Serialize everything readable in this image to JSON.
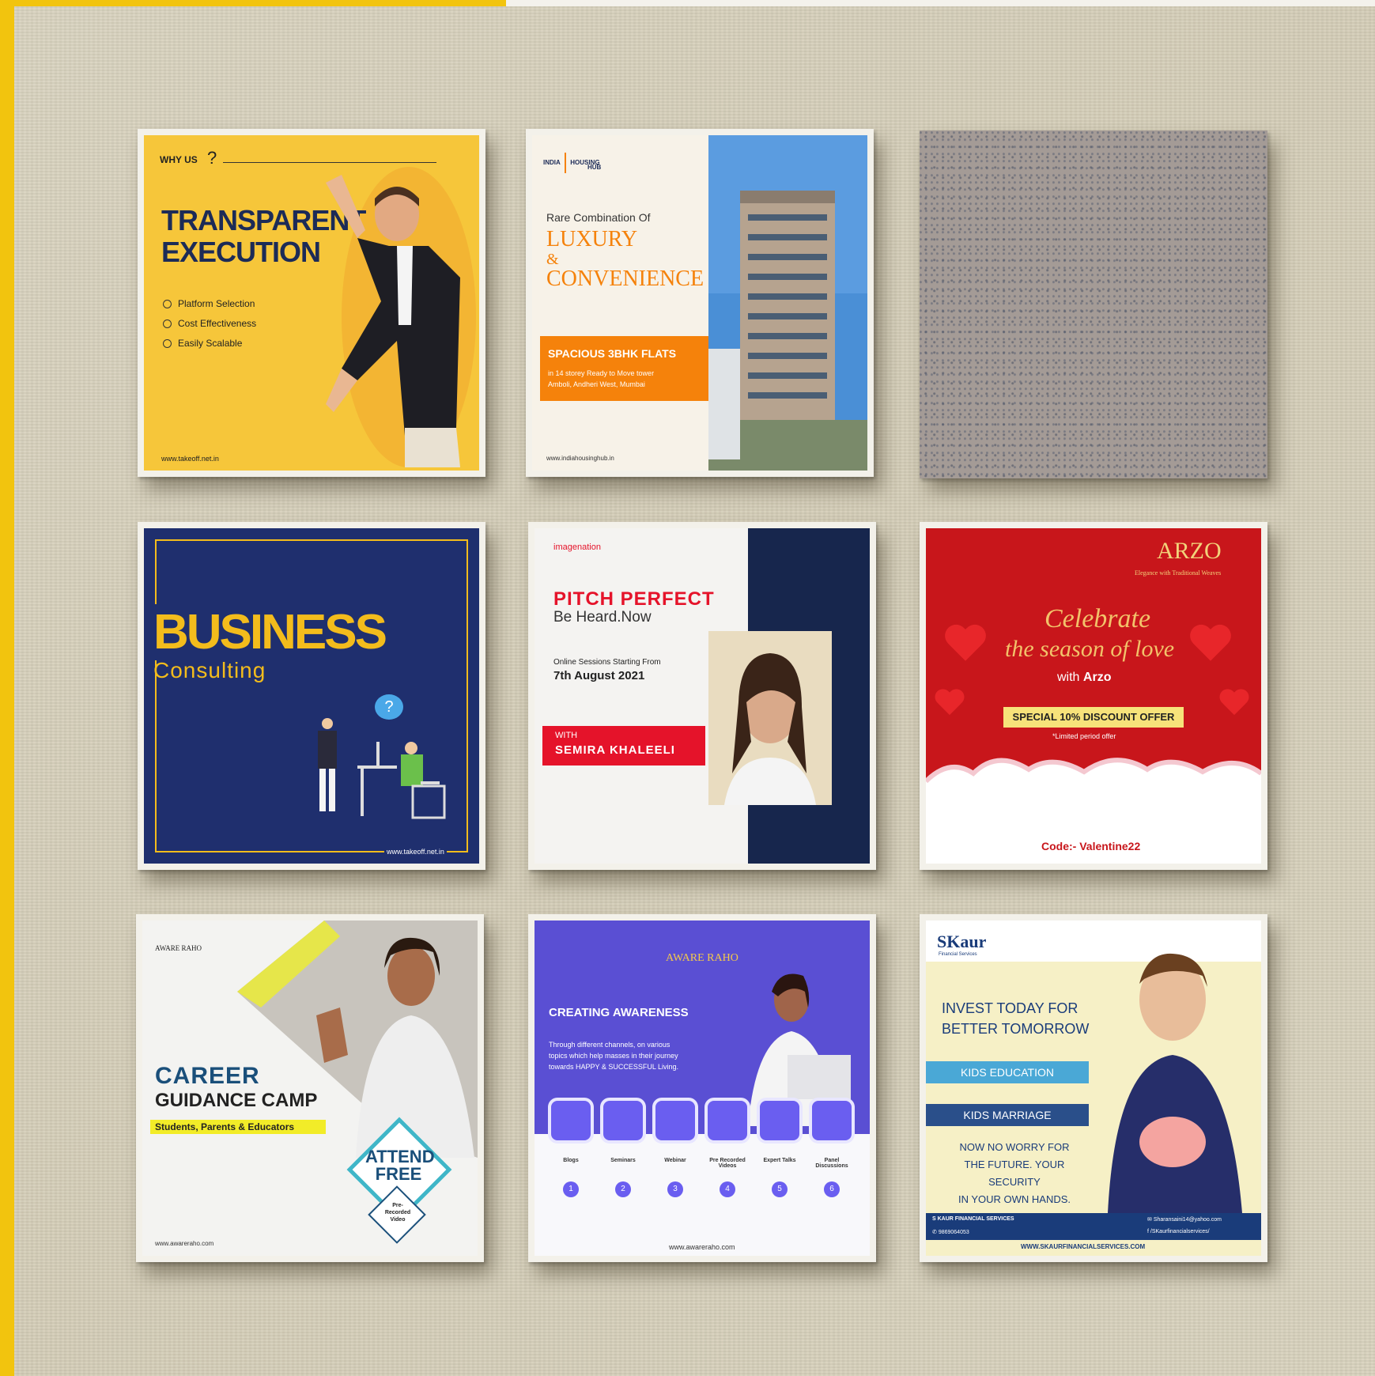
{
  "colors": {
    "yellow": "#f2c40e",
    "navy": "#1f2f6e",
    "orange": "#f5820b",
    "red": "#c8161b",
    "purple": "#5a4fd3"
  },
  "card1": {
    "why_us": "WHY US",
    "title_line1": "TRANSPARENT",
    "title_line2": "EXECUTION",
    "bullets": [
      "Platform Selection",
      "Cost Effectiveness",
      "Easily Scalable"
    ],
    "url": "www.takeoff.net.in"
  },
  "card2": {
    "logo_line1": "INDIA",
    "logo_line2": "HOUSING",
    "logo_line3": "HUB",
    "intro": "Rare Combination Of",
    "word1": "LUXURY",
    "amp": "&",
    "word2": "CONVENIENCE",
    "banner_title": "SPACIOUS 3BHK FLATS",
    "banner_line1": "in 14 storey Ready to Move tower",
    "banner_line2": "Amboli, Andheri West, Mumbai",
    "url": "www.indiahousinghub.in"
  },
  "card4": {
    "title": "BUSINESS",
    "subtitle": "Consulting",
    "question_mark": "?",
    "url": "www.takeoff.net.in"
  },
  "card5": {
    "logo": "imagenation",
    "title": "PITCH PERFECT",
    "subtitle": "Be Heard.Now",
    "sessions": "Online Sessions Starting From",
    "date": "7th August 2021",
    "with": "WITH",
    "speaker": "SEMIRA KHALEELI"
  },
  "card6": {
    "brand": "ARZO",
    "tagline": "Elegance with Traditional Weaves",
    "celebrate": "Celebrate",
    "season": "the season of love",
    "with": "with",
    "with_brand": "Arzo",
    "offer": "SPECIAL 10% DISCOUNT OFFER",
    "limited": "*Limited period offer",
    "code": "Code:- Valentine22"
  },
  "card7": {
    "logo": "AWARE RAHO",
    "title_line1": "CAREER",
    "title_line2": "GUIDANCE CAMP",
    "audience": "Students, Parents & Educators",
    "attend": "ATTEND",
    "free": "FREE",
    "badge_line1": "Pre-",
    "badge_line2": "Recorded",
    "badge_line3": "Video",
    "url": "www.awareraho.com"
  },
  "card8": {
    "logo": "AWARE RAHO",
    "title": "CREATING AWARENESS",
    "desc_line1": "Through different channels, on various",
    "desc_line2": "topics which help masses in their journey",
    "desc_line3": "towards HAPPY & SUCCESSFUL Living.",
    "channels": [
      {
        "label": "Blogs",
        "num": "1"
      },
      {
        "label": "Seminars",
        "num": "2"
      },
      {
        "label": "Webinar",
        "num": "3"
      },
      {
        "label": "Pre Recorded Videos",
        "num": "4"
      },
      {
        "label": "Expert Talks",
        "num": "5"
      },
      {
        "label": "Panel Discussions",
        "num": "6"
      }
    ],
    "url": "www.awareraho.com"
  },
  "card9": {
    "logo": "Kaur",
    "logo_sub": "Financial Services",
    "headline_line1": "INVEST TODAY FOR",
    "headline_line2": "BETTER TOMORROW",
    "bar1": "KIDS EDUCATION",
    "bar2": "KIDS MARRIAGE",
    "body_line1": "NOW NO WORRY FOR",
    "body_line2": "THE FUTURE. YOUR SECURITY",
    "body_line3": "IN YOUR OWN HANDS.",
    "company": "S KAUR FINANCIAL SERVICES",
    "phone": "9869064053",
    "email": "Sharansaini14@yahoo.com",
    "facebook": "/SKaurfinancialservices/",
    "url": "WWW.SKAURFINANCIALSERVICES.COM"
  }
}
